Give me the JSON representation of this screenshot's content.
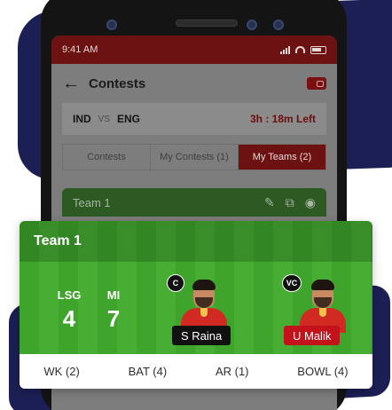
{
  "status_bar": {
    "time": "9:41 AM"
  },
  "header": {
    "title": "Contests",
    "back_icon": "arrow-left-icon",
    "wallet_icon": "wallet-icon"
  },
  "match": {
    "team_a": "IND",
    "vs": "VS",
    "team_b": "ENG",
    "time_left": "3h : 18m Left"
  },
  "tabs": [
    {
      "label": "Contests",
      "active": false
    },
    {
      "label": "My Contests (1)",
      "active": false
    },
    {
      "label": "My Teams (2)",
      "active": true
    }
  ],
  "background_team": {
    "title": "Team 1"
  },
  "card": {
    "title": "Team 1",
    "teams": [
      {
        "abbr": "LSG",
        "count": "4"
      },
      {
        "abbr": "MI",
        "count": "7"
      }
    ],
    "players": [
      {
        "role": "C",
        "name": "S Raina",
        "tag_color": "#111111"
      },
      {
        "role": "VC",
        "name": "U Malik",
        "tag_color": "#c4121c"
      }
    ],
    "footer": [
      "WK (2)",
      "BAT (4)",
      "AR (1)",
      "BOWL (4)"
    ]
  },
  "colors": {
    "brand": "#c4121c",
    "pitch_green": "#3fa42c",
    "navy": "#1c1f54"
  }
}
